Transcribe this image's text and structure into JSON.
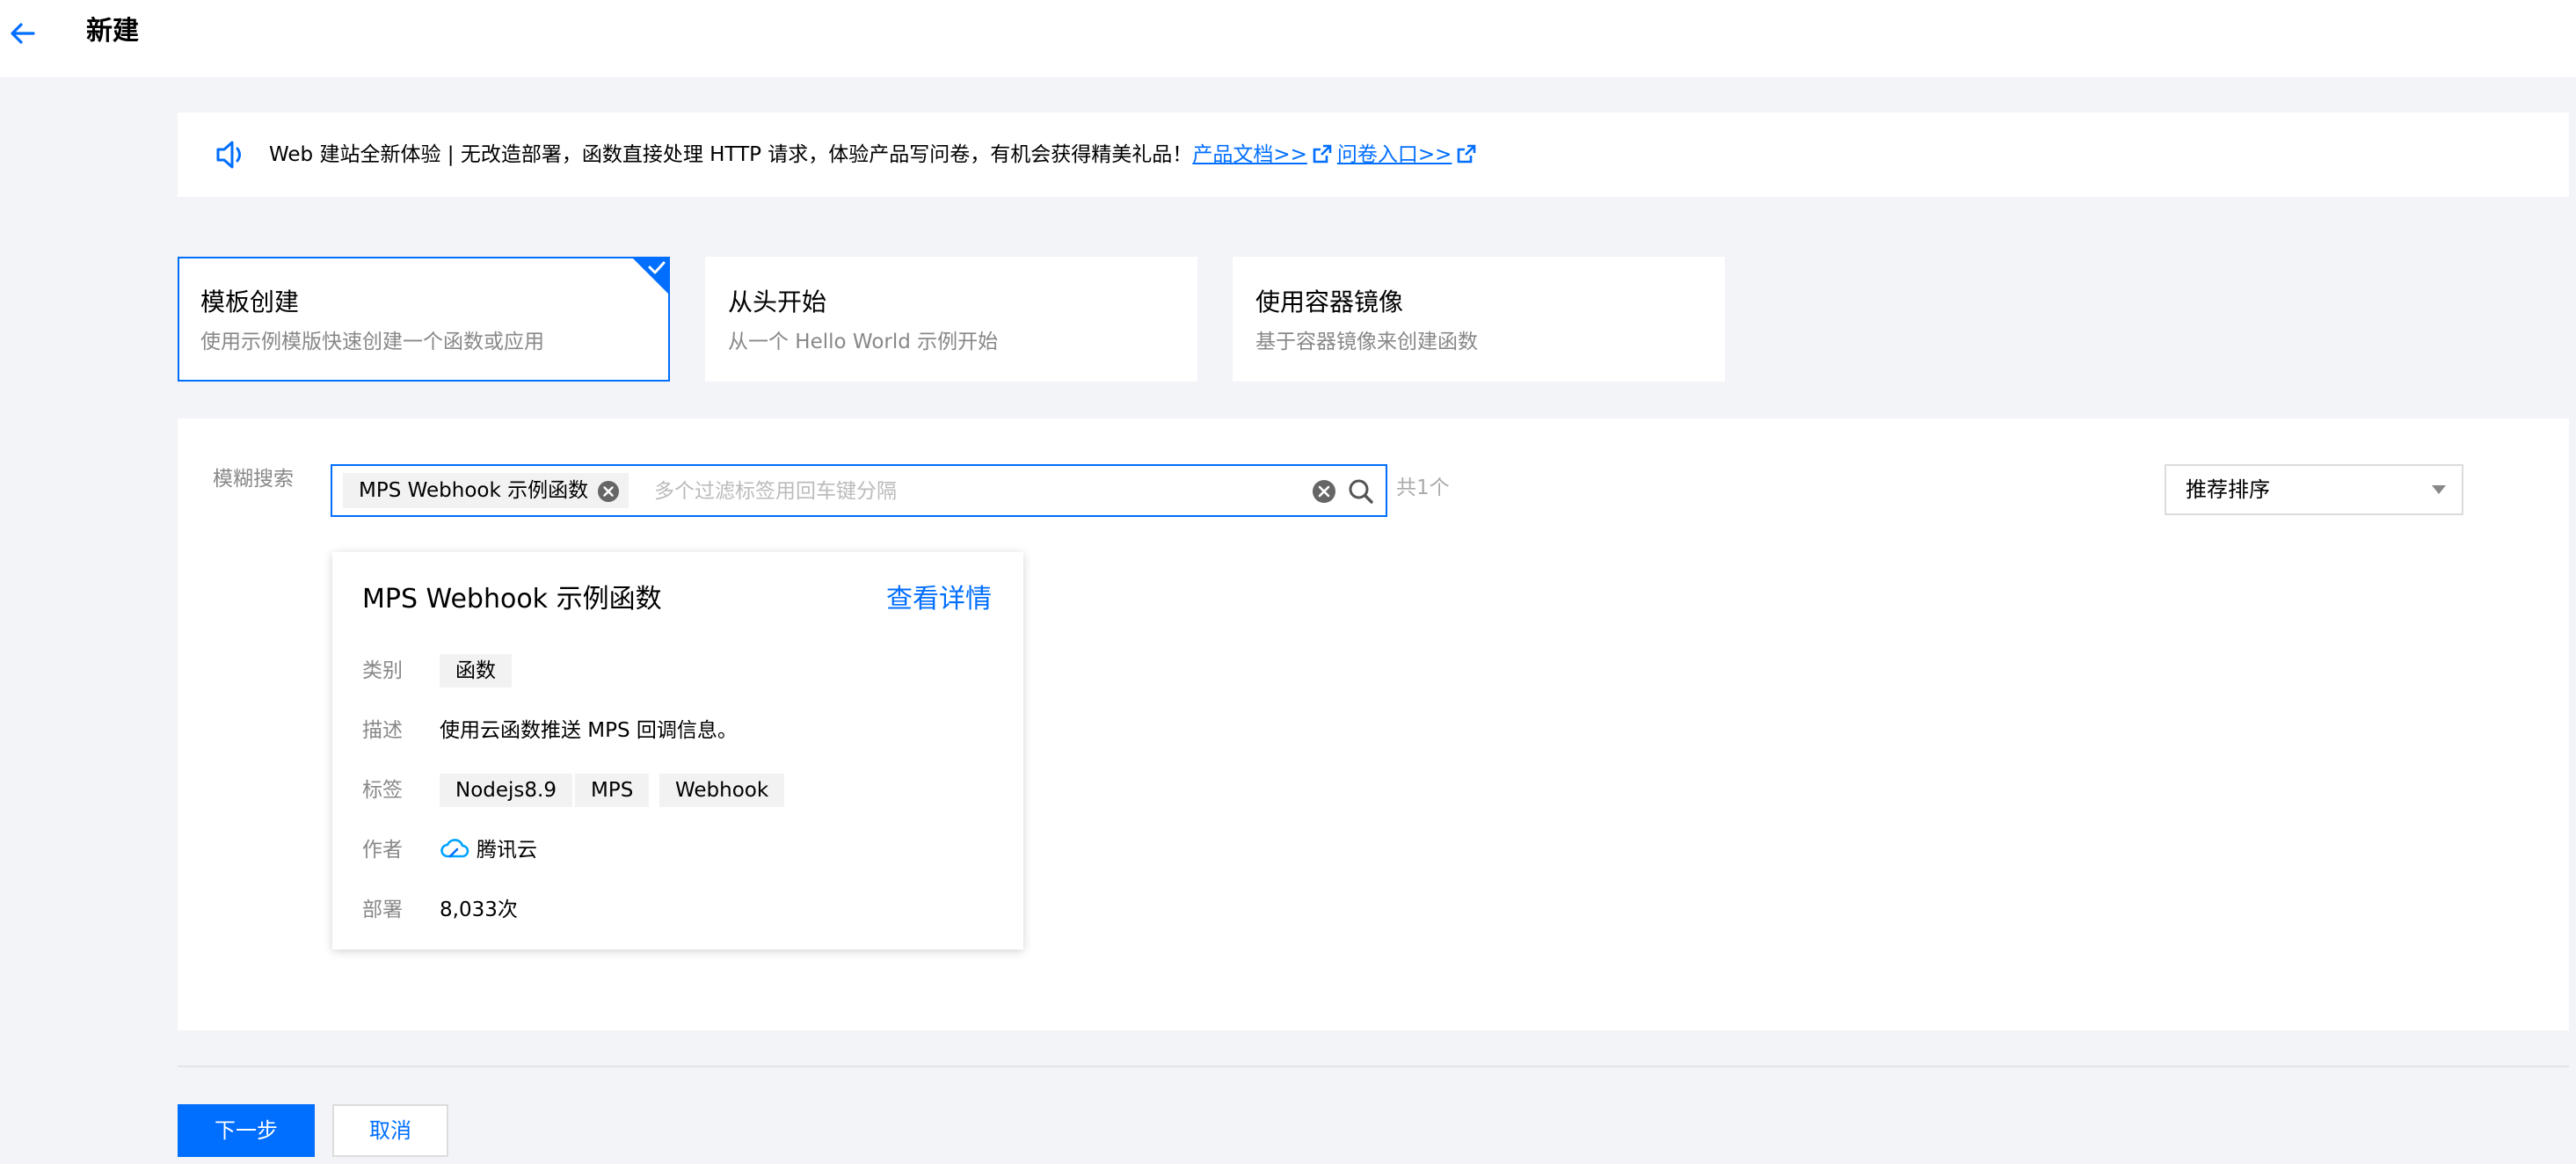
{
  "header": {
    "title": "新建"
  },
  "notice": {
    "text": "Web 建站全新体验 | 无改造部署，函数直接处理 HTTP 请求，体验产品写问卷，有机会获得精美礼品！",
    "doc_link": "产品文档>>",
    "survey_link": "问卷入口>>"
  },
  "modes": [
    {
      "title": "模板创建",
      "desc": "使用示例模版快速创建一个函数或应用",
      "selected": true
    },
    {
      "title": "从头开始",
      "desc": "从一个 Hello World 示例开始",
      "selected": false
    },
    {
      "title": "使用容器镜像",
      "desc": "基于容器镜像来创建函数",
      "selected": false
    }
  ],
  "filter": {
    "label": "模糊搜索",
    "tag": "MPS Webhook 示例函数",
    "placeholder": "多个过滤标签用回车键分隔",
    "count": "共1个"
  },
  "sort": {
    "selected": "推荐排序"
  },
  "template": {
    "title": "MPS Webhook 示例函数",
    "detail_link": "查看详情",
    "category_label": "类别",
    "category": "函数",
    "desc_label": "描述",
    "desc": "使用云函数推送 MPS 回调信息。",
    "tags_label": "标签",
    "tags": [
      "Nodejs8.9",
      "MPS",
      "Webhook"
    ],
    "author_label": "作者",
    "author": "腾讯云",
    "deploy_label": "部署",
    "deploys": "8,033次"
  },
  "footer": {
    "next_label": "下一步",
    "cancel_label": "取消"
  },
  "colors": {
    "accent": "#006eff",
    "background": "#f3f4f7",
    "muted_text": "#888888"
  }
}
